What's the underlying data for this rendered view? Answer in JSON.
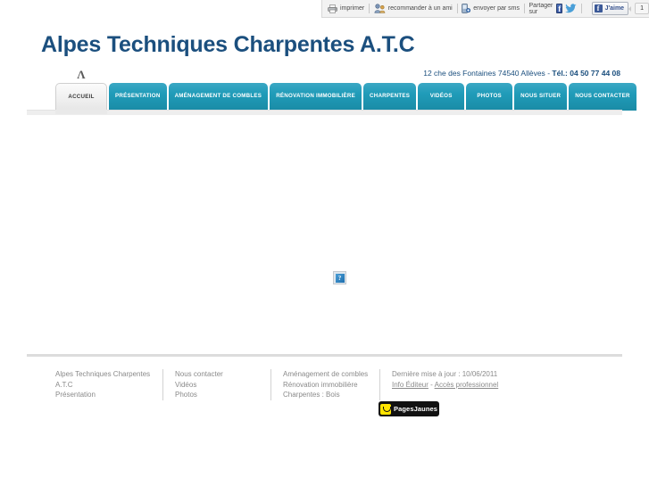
{
  "share_bar": {
    "print_label": "imprimer",
    "recommend_label": "recommander à un ami",
    "sms_label": "envoyer par sms",
    "share_on_label": "Partager sur",
    "facebook_icon_letter": "f",
    "twitter_icon_glyph": "ᴠ",
    "like_label": "J'aime",
    "like_count": "1"
  },
  "header": {
    "site_title": "Alpes Techniques Charpentes A.T.C",
    "address": "12 che des Fontaines 74540 Allèves",
    "separator": "-",
    "phone_label": "Tél.:",
    "phone": "04 50 77 44 08"
  },
  "nav": {
    "active_marker": "Λ",
    "tabs": [
      {
        "label": "ACCUEIL",
        "active": true
      },
      {
        "label": "PRÉSENTATION",
        "active": false
      },
      {
        "label": "AMÉNAGEMENT DE COMBLES",
        "active": false
      },
      {
        "label": "RÉNOVATION IMMOBILIÈRE",
        "active": false
      },
      {
        "label": "CHARPENTES",
        "active": false
      },
      {
        "label": "VIDÉOS",
        "active": false
      },
      {
        "label": "PHOTOS",
        "active": false
      },
      {
        "label": "NOUS SITUER",
        "active": false
      },
      {
        "label": "NOUS CONTACTER",
        "active": false
      }
    ]
  },
  "main": {
    "broken_image_glyph": "?"
  },
  "footer": {
    "col1": [
      "Alpes Techniques Charpentes",
      "A.T.C",
      "Présentation"
    ],
    "col2": [
      "Nous contacter",
      "Vidéos",
      "Photos"
    ],
    "col3": [
      "Aménagement de combles",
      "Rénovation immobilière",
      "Charpentes : Bois"
    ],
    "last_update": "Dernière mise à jour : 10/06/2011",
    "link_info_editeur": "Info Éditeur",
    "link_separator": "-",
    "link_acces_pro": "Accès professionnel",
    "pagesjaunes_label": "PagesJaunes"
  },
  "colors": {
    "tab_teal": "#209cb9",
    "title_navy": "#1b4f7e",
    "footer_gray": "#8a8a8a",
    "pj_yellow": "#ffe400",
    "facebook_blue": "#3b5998",
    "twitter_blue": "#4a9fd8"
  }
}
